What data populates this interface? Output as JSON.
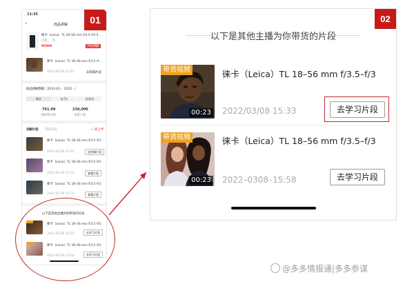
{
  "phone": {
    "badge": "01",
    "status_time": "11:35",
    "nav_title": "商品讲解",
    "product": {
      "title": "徕卡（Leica）TL 18–56 mm f/3.5–f/3.5 ...",
      "subtitle": "已售 ... 件",
      "price": "¥5999",
      "tag": "开始讲解"
    },
    "related_clip": {
      "title": "徕卡（Leica）TL 18–56 mm f/3.5–f/...",
      "date": "2022-03-08 15:22",
      "action": "去剪辑片段"
    },
    "stats": {
      "title": "商品讲解数据（2022-02-.. 2022-..）",
      "tabs": [
        "昨天",
        "近7天",
        "近30天"
      ],
      "metrics": [
        {
          "value": "761.99",
          "label": "讲解曝光数"
        },
        {
          "value": "230,000",
          "label": "观看人数"
        }
      ]
    },
    "clip_tabs": [
      "讲解片段",
      "带货片段"
    ],
    "clip_add": "+ 新上传",
    "clips": [
      {
        "title": "徕卡（Leica）TL 18–56 mm f/3.5–f/3",
        "date": "2022-03-08 15:33",
        "action": "去剪辑片段"
      },
      {
        "title": "徕卡（Leica）TL 18–56 mm f/3.5–f/3",
        "date": "2022-03-08 15:33",
        "action": "查看片段"
      },
      {
        "title": "徕卡（Leica）TL 18–56 mm f/3.5–f/3",
        "date": "2022-03-08 15:33",
        "action": "查看片段"
      }
    ],
    "others_title": "以下是其他主播为你带货的片段",
    "others": [
      {
        "title": "徕卡（Leica）TL 18–56 mm f/3.5–f/3",
        "date": "2022-03-08 15:33",
        "action": "去学习片段"
      },
      {
        "title": "徕卡（Leica）TL 18–56 mm f/3.5–f/3",
        "date": "2022-03-08 15:58",
        "action": "去学习片段"
      }
    ]
  },
  "panel": {
    "badge": "02",
    "title": "以下是其他主播为你带货的片段",
    "items": [
      {
        "badge": "带货视频",
        "duration": "00:23",
        "title": "徕卡（Leica）TL 18–56 mm f/3.5–f/3",
        "date": "2022/03/08 15:33",
        "action": "去学习片段"
      },
      {
        "badge": "带货视频",
        "duration": "00:23",
        "title": "徕卡（Leica）TL 18–56 mm f/3.5–f/3",
        "date": "2022–0308–15:58",
        "action": "去学习片段"
      }
    ]
  },
  "watermark": "@多多情报通|多多参谋",
  "colors": {
    "accent_red": "#c81a1a",
    "badge_orange": "#f0a020"
  }
}
